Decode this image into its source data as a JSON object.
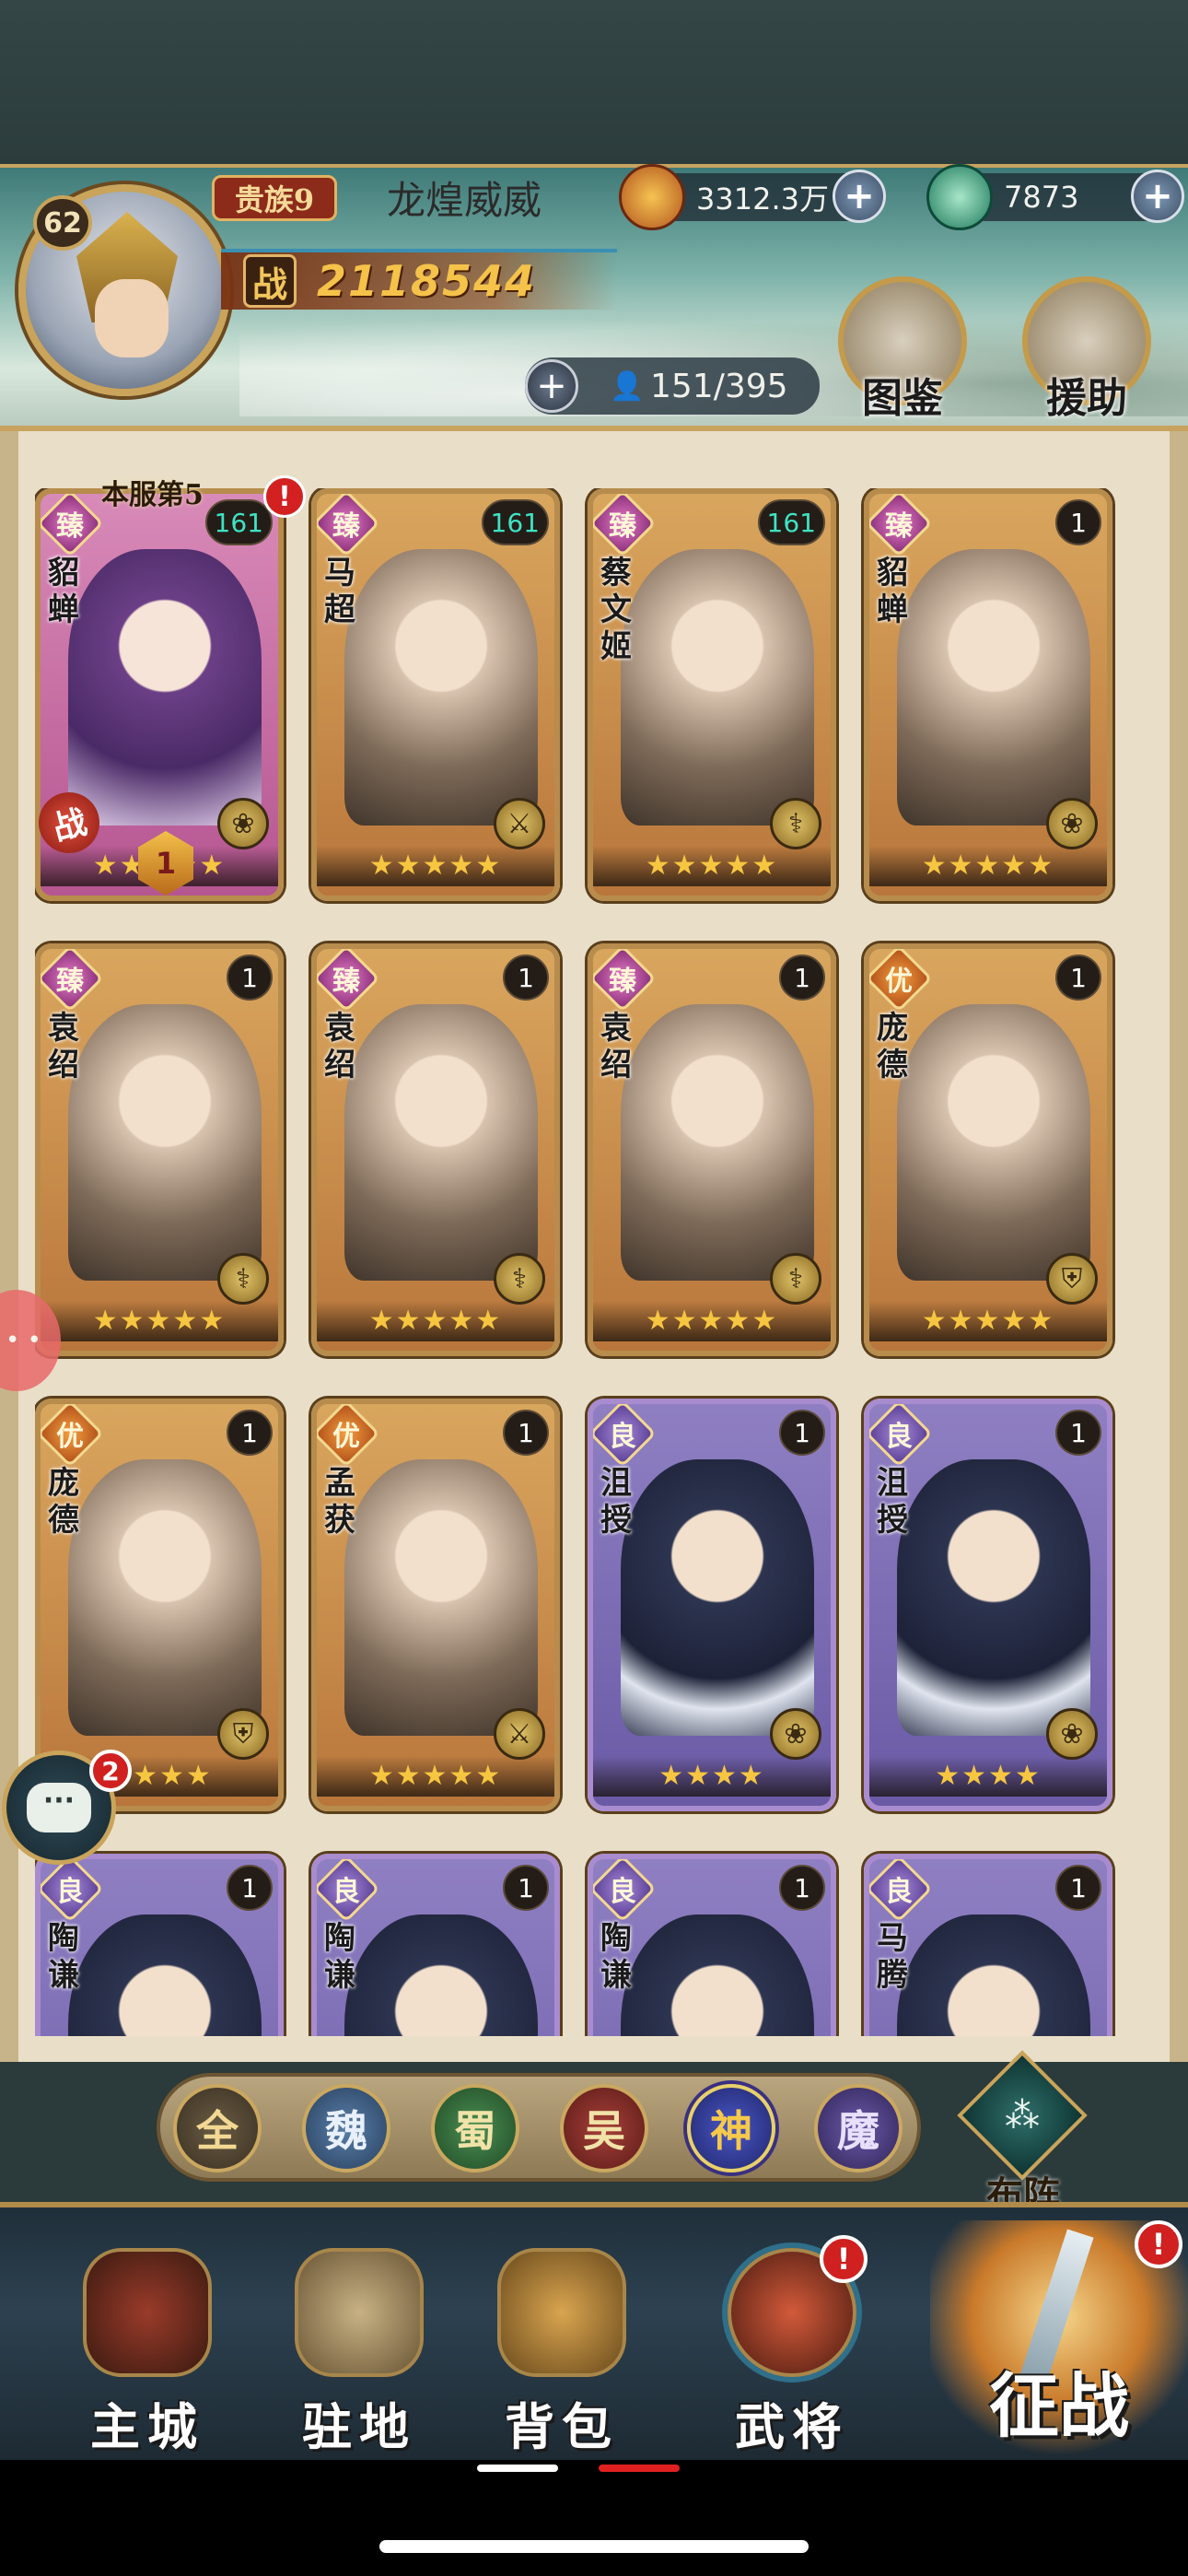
{
  "player": {
    "level": "62",
    "vip": "贵族9",
    "name": "龙煌威威",
    "power_label": "战",
    "power": "2118544"
  },
  "resources": {
    "gold": "3312.3万",
    "jade": "7873"
  },
  "roster": {
    "capacity": "151/395"
  },
  "header_buttons": {
    "codex": "图鉴",
    "help": "援助"
  },
  "server_rank": "本服第5",
  "battle_mark": "战",
  "formation_tag": "1",
  "cards": [
    {
      "name": "貂蝉",
      "rarity": "臻",
      "level": "161",
      "stars": "★★★★★",
      "type": "❀",
      "bg": "pink",
      "rclass": ""
    },
    {
      "name": "马超",
      "rarity": "臻",
      "level": "161",
      "stars": "★★★★★",
      "type": "⚔",
      "bg": "gold",
      "rclass": ""
    },
    {
      "name": "蔡文姬",
      "rarity": "臻",
      "level": "161",
      "stars": "★★★★★",
      "type": "⚕",
      "bg": "gold",
      "rclass": ""
    },
    {
      "name": "貂蝉",
      "rarity": "臻",
      "level": "1",
      "stars": "★★★★★",
      "type": "❀",
      "bg": "gold",
      "rclass": ""
    },
    {
      "name": "袁绍",
      "rarity": "臻",
      "level": "1",
      "stars": "★★★★★",
      "type": "⚕",
      "bg": "gold",
      "rclass": ""
    },
    {
      "name": "袁绍",
      "rarity": "臻",
      "level": "1",
      "stars": "★★★★★",
      "type": "⚕",
      "bg": "gold",
      "rclass": ""
    },
    {
      "name": "袁绍",
      "rarity": "臻",
      "level": "1",
      "stars": "★★★★★",
      "type": "⚕",
      "bg": "gold",
      "rclass": ""
    },
    {
      "name": "庞德",
      "rarity": "优",
      "level": "1",
      "stars": "★★★★★",
      "type": "⛨",
      "bg": "gold",
      "rclass": "you"
    },
    {
      "name": "庞德",
      "rarity": "优",
      "level": "1",
      "stars": "★★★★",
      "type": "⛨",
      "bg": "gold",
      "rclass": "you"
    },
    {
      "name": "孟获",
      "rarity": "优",
      "level": "1",
      "stars": "★★★★★",
      "type": "⚔",
      "bg": "gold",
      "rclass": "you"
    },
    {
      "name": "沮授",
      "rarity": "良",
      "level": "1",
      "stars": "★★★★",
      "type": "❀",
      "bg": "purple",
      "rclass": "liang"
    },
    {
      "name": "沮授",
      "rarity": "良",
      "level": "1",
      "stars": "★★★★",
      "type": "❀",
      "bg": "purple",
      "rclass": "liang"
    },
    {
      "name": "陶谦",
      "rarity": "良",
      "level": "1",
      "stars": "",
      "type": "",
      "bg": "purple",
      "rclass": "liang"
    },
    {
      "name": "陶谦",
      "rarity": "良",
      "level": "1",
      "stars": "",
      "type": "",
      "bg": "purple",
      "rclass": "liang"
    },
    {
      "name": "陶谦",
      "rarity": "良",
      "level": "1",
      "stars": "",
      "type": "",
      "bg": "purple",
      "rclass": "liang"
    },
    {
      "name": "马腾",
      "rarity": "良",
      "level": "1",
      "stars": "",
      "type": "",
      "bg": "purple",
      "rclass": "liang"
    }
  ],
  "filters": {
    "all": "全",
    "wei": "魏",
    "shu": "蜀",
    "wu": "吴",
    "shen": "神",
    "mo": "魔"
  },
  "formation": "布阵",
  "nav": {
    "city": "主城",
    "garrison": "驻地",
    "bag": "背包",
    "general": "武将",
    "battle": "征战"
  },
  "badges": {
    "alert": "!",
    "chat_count": "2"
  }
}
